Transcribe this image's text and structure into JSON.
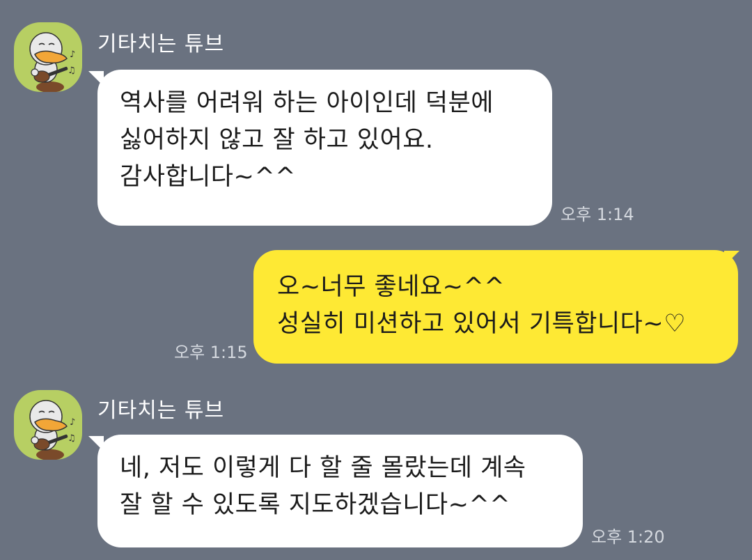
{
  "theme": {
    "background": "#6a7280",
    "incoming_bubble": "#ffffff",
    "outgoing_bubble": "#fee934",
    "avatar_background": "#b7cf63"
  },
  "messages": [
    {
      "direction": "incoming",
      "sender": "기타치는 튜브",
      "avatar_icon": "tube-duck-guitar-avatar",
      "lines": [
        "역사를 어려워 하는 아이인데 덕분에",
        "싫어하지 않고 잘 하고 있어요.",
        "감사합니다~^^"
      ],
      "time": "오후 1:14"
    },
    {
      "direction": "outgoing",
      "lines": [
        "오~너무 좋네요~^^",
        "성실히 미션하고 있어서 기특합니다~♡"
      ],
      "time": "오후 1:15"
    },
    {
      "direction": "incoming",
      "sender": "기타치는 튜브",
      "avatar_icon": "tube-duck-guitar-avatar",
      "lines": [
        "네, 저도 이렇게 다 할 줄 몰랐는데 계속",
        "잘 할 수 있도록 지도하겠습니다~^^"
      ],
      "time": "오후 1:20"
    }
  ]
}
